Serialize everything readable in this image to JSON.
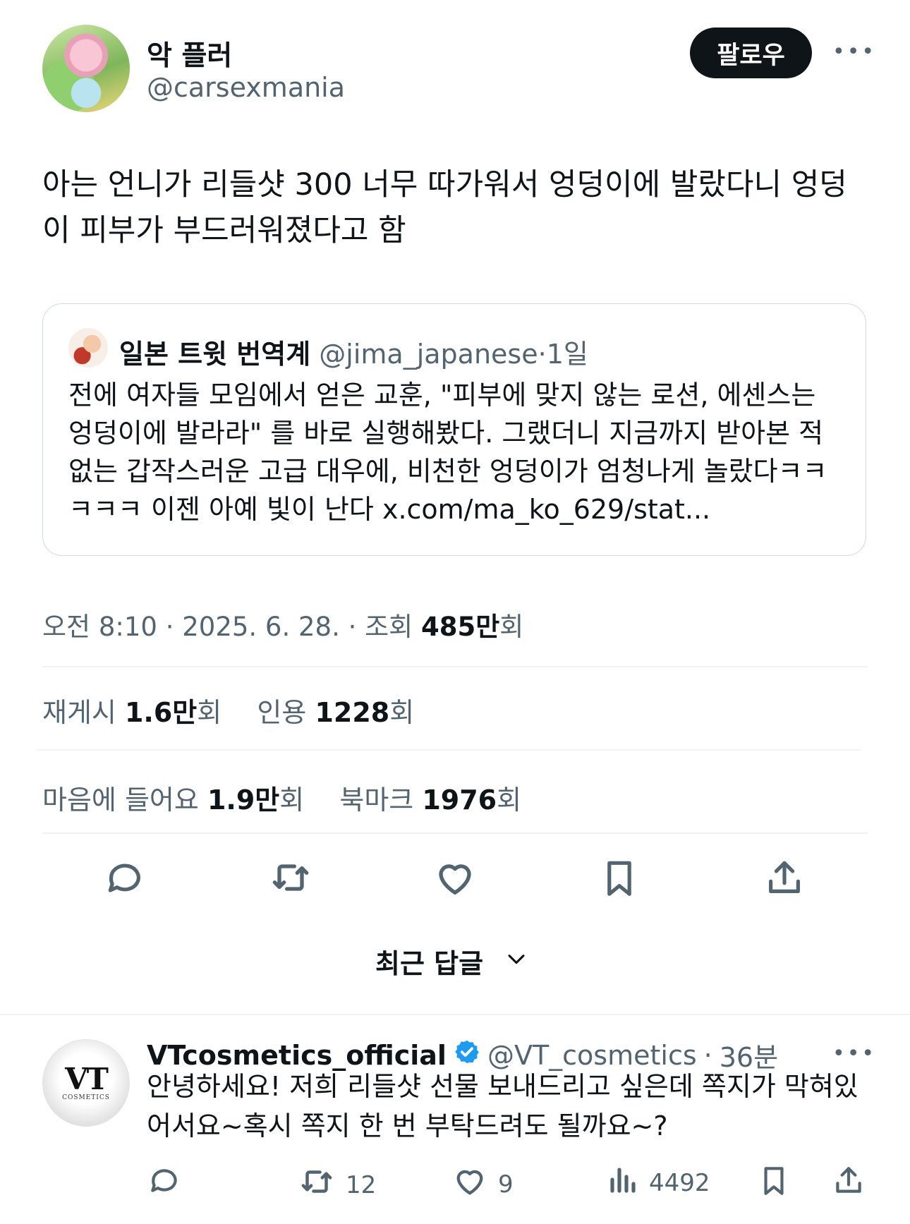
{
  "author": {
    "display_name": "악 플러",
    "handle": "@carsexmania",
    "follow_label": "팔로우",
    "more_label": "•••"
  },
  "tweet": {
    "text": "아는 언니가 리들샷 300 너무 따가워서 엉덩이에 발랐다니 엉덩이 피부가 부드러워졌다고 함"
  },
  "quote": {
    "name": "일본 트윗 번역계",
    "handle": "@jima_japanese",
    "sep": "·",
    "time": "1일",
    "text": "전에 여자들 모임에서 얻은 교훈, \"피부에 맞지 않는 로션, 에센스는 엉덩이에 발라라\" 를 바로 실행해봤다. 그랬더니 지금까지 받아본 적 없는 갑작스러운 고급 대우에, 비천한 엉덩이가 엄청나게 놀랐다ㅋㅋㅋㅋㅋ 이젠 아예 빛이 난다 x.com/ma_ko_629/stat..."
  },
  "meta": {
    "time": "오전 8:10",
    "sep": "·",
    "date": "2025. 6. 28.",
    "views_label": "조회",
    "views_value": "485만",
    "views_suffix": "회"
  },
  "stats": {
    "retweets_label": "재게시",
    "retweets_value": "1.6만",
    "retweets_suffix": "회",
    "quotes_label": "인용",
    "quotes_value": "1228",
    "quotes_suffix": "회",
    "likes_label": "마음에 들어요",
    "likes_value": "1.9만",
    "likes_suffix": "회",
    "bookmarks_label": "북마크",
    "bookmarks_value": "1976",
    "bookmarks_suffix": "회"
  },
  "sort": {
    "label": "최근 답글"
  },
  "reply": {
    "name": "VTcosmetics_official",
    "handle": "@VT_cosmetics",
    "sep": "·",
    "time": "36분",
    "avatar_mark": "VT",
    "avatar_sub": "COSMETICS",
    "text": "안녕하세요! 저희 리들샷 선물 보내드리고 싶은데 쪽지가 막혀있어서요~혹시 쪽지 한 번 부탁드려도 될까요~?",
    "retweets": "12",
    "likes": "9",
    "views": "4492",
    "more_label": "•••"
  },
  "colors": {
    "text": "#0f1419",
    "secondary": "#536471",
    "border": "#cfd9de",
    "verified": "#1d9bf0"
  }
}
